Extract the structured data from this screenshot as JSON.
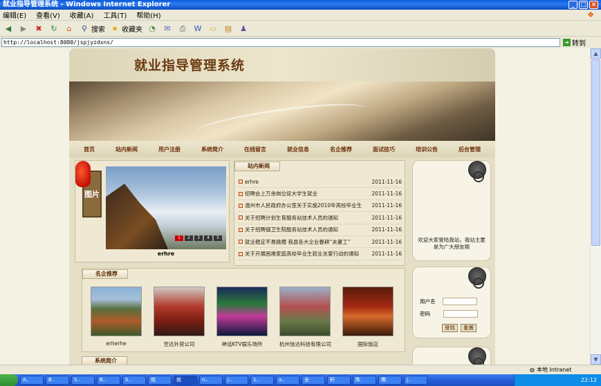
{
  "window": {
    "title": "就业指导管理系统 - Windows Internet Explorer"
  },
  "menu": {
    "items": [
      "编辑(E)",
      "查看(V)",
      "收藏(A)",
      "工具(T)",
      "帮助(H)"
    ]
  },
  "toolbar": {
    "search_label": "搜索",
    "favorites_label": "收藏夹"
  },
  "address": {
    "url": "http://localhost:8080/jspjyzdxns/",
    "go_label": "转到"
  },
  "site": {
    "title": "就业指导管理系统",
    "nav": [
      "首页",
      "站内新闻",
      "用户注册",
      "系统简介",
      "在线留言",
      "就业信息",
      "名企推荐",
      "面试技巧",
      "培训公告",
      "后台管理"
    ],
    "slideshow": {
      "tag": "图片",
      "caption": "erhre",
      "numbers": [
        "1",
        "2",
        "3",
        "4",
        "5"
      ],
      "active": "1"
    },
    "news": {
      "tab": "站内新闻",
      "items": [
        {
          "title": "erhre",
          "date": "2011-11-16"
        },
        {
          "title": "招聘会上万余岗位促大学生就业",
          "date": "2011-11-16"
        },
        {
          "title": "温州市人民政府办公室关于实施2010年高校毕业生",
          "date": "2011-11-16"
        },
        {
          "title": "关于招聘计划生育服务站技术人员的通知",
          "date": "2011-11-16"
        },
        {
          "title": "关于招聘镇卫生院服务站技术人员的通知",
          "date": "2011-11-16"
        },
        {
          "title": "就业稳定不易跳槽 我县各大企业春耕“夫妻工”",
          "date": "2011-11-16"
        },
        {
          "title": "关于开展困难家庭高校毕业生就业关爱行动的通知",
          "date": "2011-11-16"
        }
      ]
    },
    "welcome": "欢迎大家登陆我站，我站主要是为广大朋友精",
    "login": {
      "username_label": "用户名",
      "password_label": "密码",
      "login_button": "登陆",
      "reset_button": "重置"
    },
    "companies": {
      "tab": "名企推荐",
      "items": [
        {
          "name": "erherhe"
        },
        {
          "name": "世达外贸公司"
        },
        {
          "name": "神话KTV娱乐场所"
        },
        {
          "name": "杭州信达科技有限公司"
        },
        {
          "name": "国际饭店"
        }
      ]
    },
    "intro_tab": "系统简介"
  },
  "statusbar": {
    "zone": "本地 Intranet"
  },
  "taskbar": {
    "tasks": [
      "A..",
      "B..",
      "S..",
      "B..",
      "S..",
      "就",
      "就",
      "n..",
      "j..",
      "1..",
      "a..",
      "全",
      "轩",
      "陈",
      "佛",
      "j..",
      "读",
      "a..",
      "a.."
    ],
    "clock": "22:12"
  }
}
